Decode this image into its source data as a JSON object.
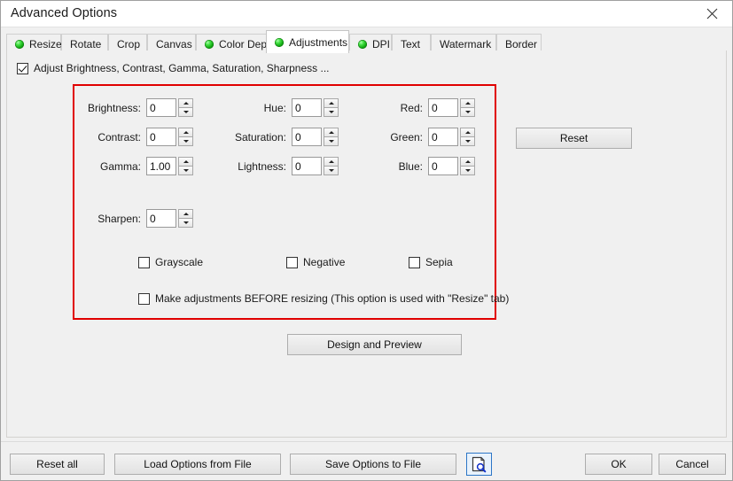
{
  "window": {
    "title": "Advanced Options",
    "close_icon": "close-icon"
  },
  "tabs": [
    {
      "label": "Resize",
      "led": true,
      "active": false
    },
    {
      "label": "Rotate",
      "led": false,
      "active": false
    },
    {
      "label": "Crop",
      "led": false,
      "active": false
    },
    {
      "label": "Canvas",
      "led": false,
      "active": false
    },
    {
      "label": "Color Depth",
      "led": true,
      "active": false
    },
    {
      "label": "Adjustments",
      "led": true,
      "active": true
    },
    {
      "label": "DPI",
      "led": true,
      "active": false
    },
    {
      "label": "Text",
      "led": false,
      "active": false
    },
    {
      "label": "Watermark",
      "led": false,
      "active": false
    },
    {
      "label": "Border",
      "led": false,
      "active": false
    }
  ],
  "enable": {
    "label": "Adjust Brightness, Contrast, Gamma, Saturation, Sharpness ...",
    "checked": true
  },
  "fields": {
    "brightness": {
      "label": "Brightness:",
      "value": "0"
    },
    "contrast": {
      "label": "Contrast:",
      "value": "0"
    },
    "gamma": {
      "label": "Gamma:",
      "value": "1.00"
    },
    "sharpen": {
      "label": "Sharpen:",
      "value": "0"
    },
    "hue": {
      "label": "Hue:",
      "value": "0"
    },
    "saturation": {
      "label": "Saturation:",
      "value": "0"
    },
    "lightness": {
      "label": "Lightness:",
      "value": "0"
    },
    "red": {
      "label": "Red:",
      "value": "0"
    },
    "green": {
      "label": "Green:",
      "value": "0"
    },
    "blue": {
      "label": "Blue:",
      "value": "0"
    }
  },
  "modes": {
    "grayscale": {
      "label": "Grayscale",
      "checked": false
    },
    "negative": {
      "label": "Negative",
      "checked": false
    },
    "sepia": {
      "label": "Sepia",
      "checked": false
    },
    "before_resize": {
      "label": "Make adjustments BEFORE resizing (This option is used with \"Resize\" tab)",
      "checked": false
    }
  },
  "buttons": {
    "reset": "Reset",
    "design_and_preview": "Design and Preview",
    "reset_all": "Reset all",
    "load_options": "Load Options from File",
    "save_options": "Save Options to File",
    "ok": "OK",
    "cancel": "Cancel",
    "preview_icon": "document-preview-icon"
  },
  "colors": {
    "highlight_border": "#e00000",
    "led_green": "#11a711",
    "preview_icon_accent": "#2c76c7"
  }
}
